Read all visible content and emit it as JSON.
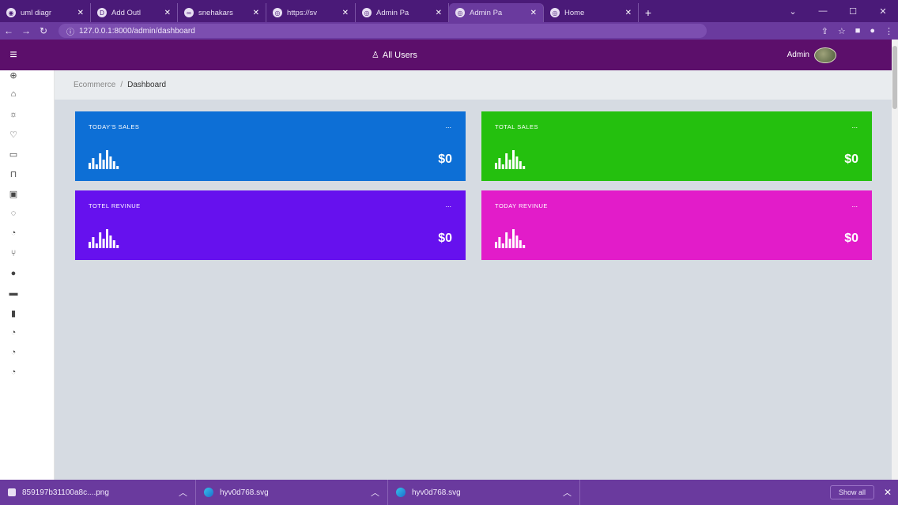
{
  "browser": {
    "tabs": [
      {
        "label": "uml diagr",
        "icon": "chrome-icon",
        "active": false
      },
      {
        "label": "Add Outl",
        "icon": "outline-icon",
        "active": false
      },
      {
        "label": "snehakars",
        "icon": "link-icon",
        "active": false
      },
      {
        "label": "https://sv",
        "icon": "globe-icon",
        "active": false
      },
      {
        "label": "Admin Pa",
        "icon": "globe-icon",
        "active": false
      },
      {
        "label": "Admin Pa",
        "icon": "globe-icon",
        "active": true
      },
      {
        "label": "Home",
        "icon": "globe-icon",
        "active": false
      }
    ],
    "url": "127.0.0.1:8000/admin/dashboard"
  },
  "header": {
    "all_users": "All Users",
    "admin_label": "Admin"
  },
  "breadcrumb": {
    "parent": "Ecommerce",
    "separator": "/",
    "current": "Dashboard"
  },
  "cards": [
    {
      "title": "TODAY'S SALES",
      "value": "$0",
      "more": "...",
      "color": "#0d6fd6"
    },
    {
      "title": "TOTAL SALES",
      "value": "$0",
      "more": "...",
      "color": "#24c00e"
    },
    {
      "title": "TOTEL REVINUE",
      "value": "$0",
      "more": "...",
      "color": "#6611ee"
    },
    {
      "title": "TODAY REVINUE",
      "value": "$0",
      "more": "...",
      "color": "#e21cc9"
    }
  ],
  "sidebar_icons": [
    "globe-icon",
    "home-icon",
    "bulb-icon",
    "heart-icon",
    "card-icon",
    "folder-icon",
    "calendar-icon",
    "location-icon",
    "pie-chart-icon",
    "git-icon",
    "info-icon",
    "truck-icon",
    "bookmark-icon",
    "pie-chart-icon",
    "pie-chart-icon",
    "pie-chart-icon"
  ],
  "downloads": [
    {
      "name": "859197b31100a8c....png",
      "icon": "image-file-icon"
    },
    {
      "name": "hyv0d768.svg",
      "icon": "edge-icon"
    },
    {
      "name": "hyv0d768.svg",
      "icon": "edge-icon"
    }
  ],
  "download_bar": {
    "show_all": "Show all"
  },
  "colors": {
    "tabstrip": "#4a1a78",
    "addressbar": "#6a3a9e",
    "app_header": "#5c0f6b",
    "content_bg": "#d6dbe2"
  }
}
